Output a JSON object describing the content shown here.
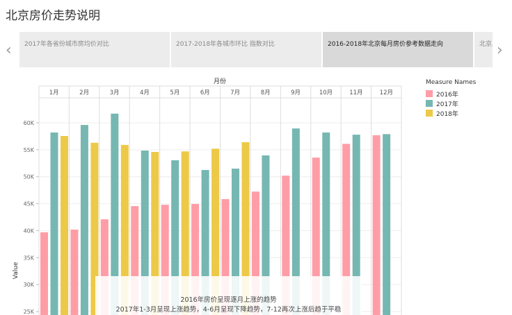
{
  "title": "北京房价走势说明",
  "tabs": [
    "2017年各省份城市房均价对比",
    "2017-2018年各城市环比 指数对比",
    "2016-2018年北京每月房价参考数据走向",
    "北京房"
  ],
  "active_tab": 2,
  "nav": {
    "prev": "‹",
    "next": "›"
  },
  "legend": {
    "title": "Measure Names",
    "items": [
      {
        "label": "2016年",
        "color": "#ff9da7"
      },
      {
        "label": "2017年",
        "color": "#76b7b2"
      },
      {
        "label": "2018年",
        "color": "#edc948"
      }
    ]
  },
  "note": {
    "line1": "2016年房价呈现逐月上涨的趋势",
    "line2": "2017年1-3月呈现上涨趋势，4-6月呈现下降趋势，7-12再次上涨后趋于平稳"
  },
  "chart_data": {
    "type": "bar",
    "title": "",
    "xlabel": "月份",
    "ylabel": "Value",
    "categories": [
      "1月",
      "2月",
      "3月",
      "4月",
      "5月",
      "6月",
      "7月",
      "8月",
      "9月",
      "10月",
      "11月",
      "12月"
    ],
    "yticks": [
      25000,
      30000,
      35000,
      40000,
      45000,
      50000,
      55000,
      60000
    ],
    "ytick_labels": [
      "25K",
      "30K",
      "35K",
      "40K",
      "45K",
      "50K",
      "55K",
      "60K"
    ],
    "ylim": [
      22000,
      64000
    ],
    "series": [
      {
        "name": "2016年",
        "color": "#ff9da7",
        "values": [
          39700,
          40200,
          42100,
          44550,
          44800,
          44950,
          45850,
          47250,
          50200,
          53550,
          56100,
          57700
        ]
      },
      {
        "name": "2017年",
        "color": "#76b7b2",
        "values": [
          58200,
          59600,
          61700,
          54850,
          53050,
          51250,
          51500,
          53950,
          58950,
          58200,
          57800,
          57900
        ]
      },
      {
        "name": "2018年",
        "color": "#edc948",
        "values": [
          57550,
          56300,
          55900,
          54600,
          54700,
          55200,
          56400,
          null,
          null,
          null,
          null,
          null
        ]
      }
    ]
  }
}
